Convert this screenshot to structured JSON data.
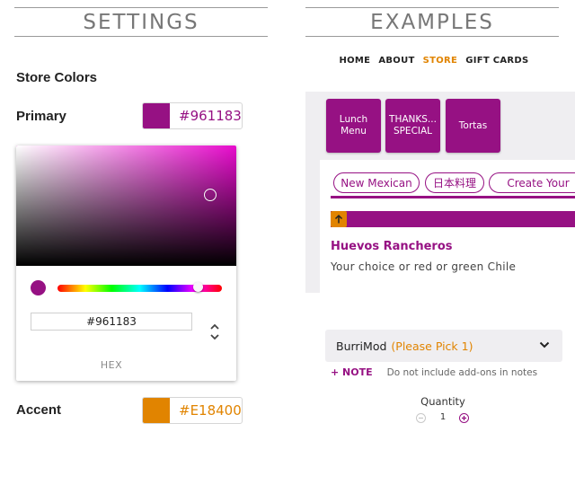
{
  "settings": {
    "title": "SETTINGS",
    "store_colors_label": "Store Colors",
    "primary": {
      "label": "Primary",
      "hex": "#961183",
      "color": "#961183"
    },
    "accent": {
      "label": "Accent",
      "hex": "#E18400",
      "color": "#E18400"
    },
    "picker": {
      "hex_value": "#961183",
      "format_label": "HEX",
      "hue_color": "#e80ccd",
      "selected_color": "#961183",
      "hue_degrees": 307,
      "saturation_pct": 88,
      "brightness_pct": 59
    }
  },
  "examples": {
    "title": "EXAMPLES",
    "nav": [
      {
        "label": "HOME",
        "active": false
      },
      {
        "label": "ABOUT",
        "active": false
      },
      {
        "label": "STORE",
        "active": true
      },
      {
        "label": "GIFT CARDS",
        "active": false
      }
    ],
    "categories": [
      {
        "label": "Lunch\nMenu"
      },
      {
        "label": "THANKS...\nSPECIAL"
      },
      {
        "label": "Tortas"
      }
    ],
    "filters": [
      "New Mexican",
      "日本料理",
      "Create Your"
    ],
    "item": {
      "name": "Huevos Rancheros",
      "description": "Your choice or red or green Chile"
    },
    "modifier": {
      "name": "BurriMod",
      "hint": "(Please Pick 1)"
    },
    "note": {
      "label": "+ NOTE",
      "hint": "Do not include add-ons in notes"
    },
    "quantity": {
      "label": "Quantity",
      "value": "1",
      "minus_icon": "minus-circle-icon",
      "plus_icon": "plus-circle-icon"
    }
  },
  "colors": {
    "primary": "#961183",
    "accent": "#E18400",
    "panel_gray": "#efeef1"
  }
}
